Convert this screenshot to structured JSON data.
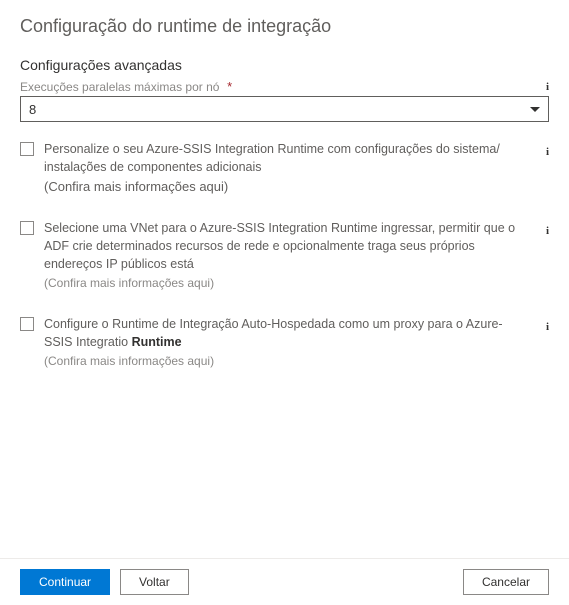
{
  "title": "Configuração do runtime de integração",
  "section_heading": "Configurações avançadas",
  "field": {
    "label": "Execuções paralelas máximas por nó",
    "required_marker": "*",
    "value": "8"
  },
  "options": [
    {
      "main": "Personalize o seu Azure-SSIS Integration Runtime com configurações do sistema/ instalações de componentes adicionais",
      "hint": "(Confira mais informações aqui)",
      "hint_large": true,
      "bold_tail": ""
    },
    {
      "main": "Selecione uma VNet para o Azure-SSIS Integration Runtime ingressar, permitir que o ADF crie determinados recursos de rede e opcionalmente traga seus próprios endereços IP públicos está",
      "hint": "(Confira mais informações aqui)",
      "hint_large": false,
      "bold_tail": ""
    },
    {
      "main": "Configure o Runtime de Integração Auto-Hospedada como um proxy para o Azure-SSIS Integratio",
      "hint": "(Confira mais informações aqui)",
      "hint_large": false,
      "bold_tail": "Runtime"
    }
  ],
  "buttons": {
    "continue": "Continuar",
    "back": "Voltar",
    "cancel": "Cancelar"
  }
}
